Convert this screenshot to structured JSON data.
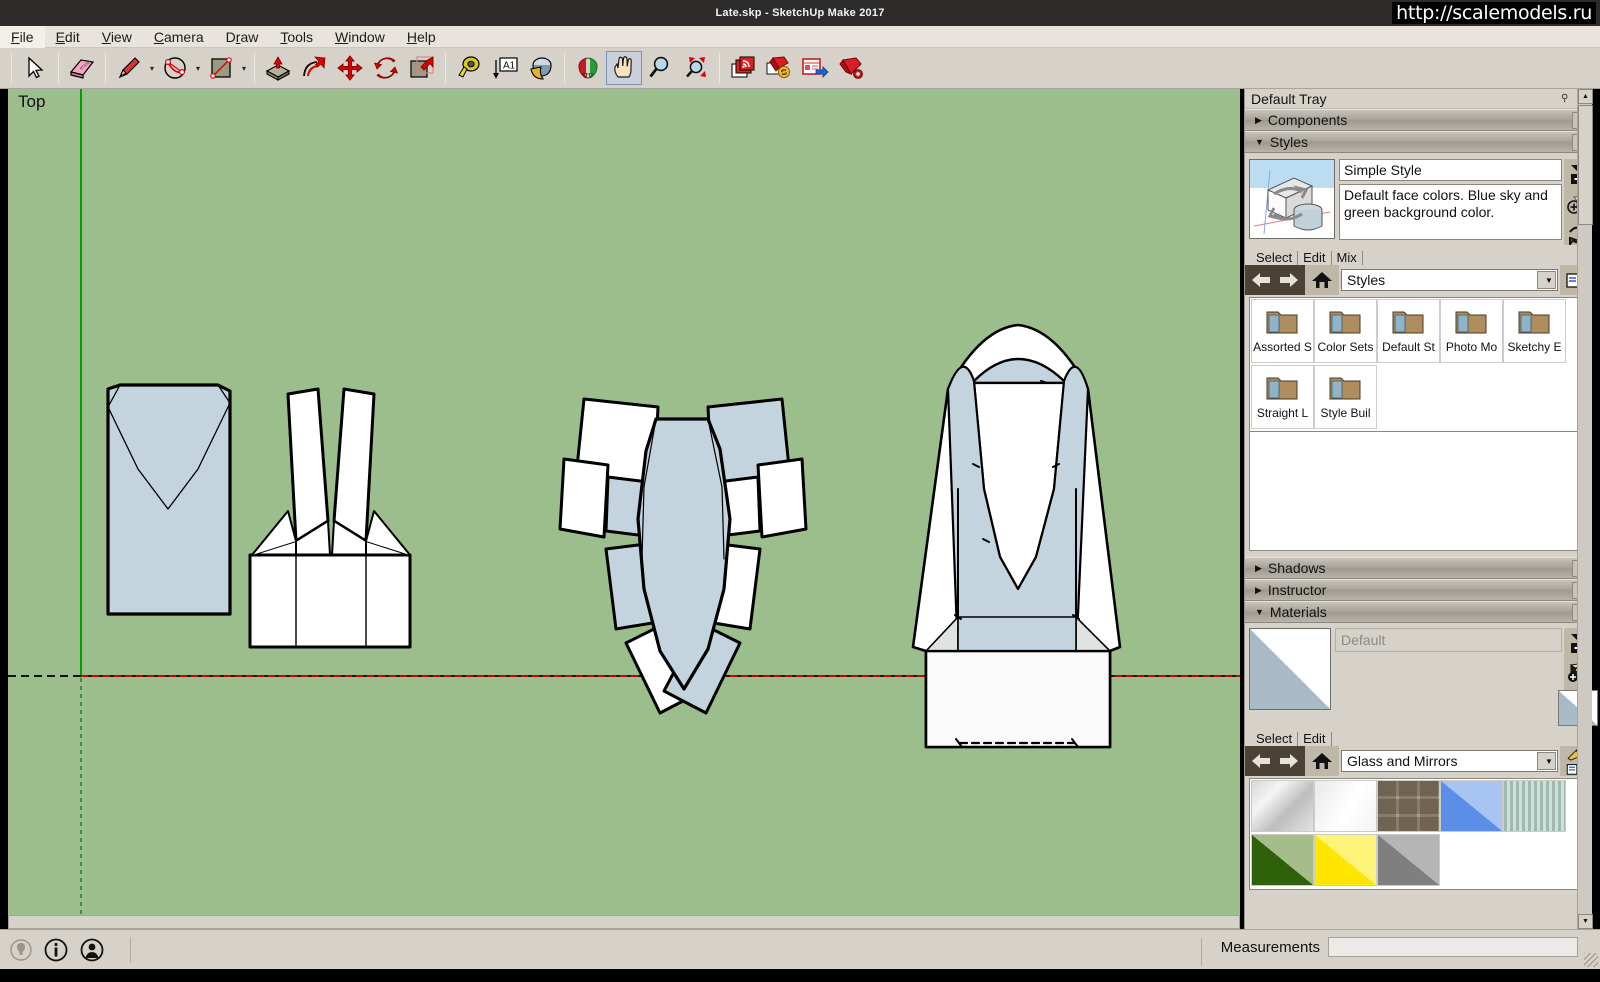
{
  "window": {
    "title": "Late.skp - SketchUp Make 2017",
    "watermark": "http://scalemodels.ru"
  },
  "menubar": {
    "items": [
      {
        "label": "File",
        "mnemonic": "F"
      },
      {
        "label": "Edit",
        "mnemonic": "E"
      },
      {
        "label": "View",
        "mnemonic": "V"
      },
      {
        "label": "Camera",
        "mnemonic": "C"
      },
      {
        "label": "Draw",
        "mnemonic": "D"
      },
      {
        "label": "Tools",
        "mnemonic": "T"
      },
      {
        "label": "Window",
        "mnemonic": "W"
      },
      {
        "label": "Help",
        "mnemonic": "H"
      }
    ]
  },
  "toolbar": {
    "tools": [
      {
        "name": "select-tool",
        "icon": "cursor-arrow-icon",
        "active": false
      },
      {
        "name": "eraser-tool",
        "icon": "eraser-icon",
        "active": false
      },
      {
        "name": "line-tool",
        "icon": "pencil-icon",
        "active": false,
        "caret": true
      },
      {
        "name": "arc-tool",
        "icon": "arc-icon",
        "active": false,
        "caret": true
      },
      {
        "name": "rectangle-tool",
        "icon": "rectangle-icon",
        "active": false,
        "caret": true
      },
      {
        "name": "pushpull-tool",
        "icon": "push-pull-icon",
        "active": false
      },
      {
        "name": "followme-tool",
        "icon": "follow-me-icon",
        "active": false
      },
      {
        "name": "move-tool",
        "icon": "move-icon",
        "active": false
      },
      {
        "name": "rotate-tool",
        "icon": "rotate-icon",
        "active": false
      },
      {
        "name": "scale-tool",
        "icon": "scale-icon",
        "active": false
      },
      {
        "name": "tape-measure-tool",
        "icon": "tape-measure-icon",
        "active": false
      },
      {
        "name": "text-tool",
        "icon": "text-a1-icon",
        "active": false
      },
      {
        "name": "paint-bucket-tool",
        "icon": "paint-bucket-icon",
        "active": false
      },
      {
        "name": "orbit-tool",
        "icon": "orbit-icon",
        "active": false
      },
      {
        "name": "pan-tool",
        "icon": "hand-pan-icon",
        "active": true
      },
      {
        "name": "zoom-tool",
        "icon": "magnifier-icon",
        "active": false
      },
      {
        "name": "zoom-extents-tool",
        "icon": "zoom-extents-icon",
        "active": false
      },
      {
        "name": "get-models-button",
        "icon": "warehouse-models-icon",
        "active": false
      },
      {
        "name": "share-model-button",
        "icon": "share-model-icon",
        "active": false
      },
      {
        "name": "extension-warehouse-button",
        "icon": "extension-warehouse-icon",
        "active": false
      },
      {
        "name": "extension-manager-button",
        "icon": "ruby-gear-icon",
        "active": false
      }
    ]
  },
  "viewport": {
    "view_label": "Top",
    "background_color": "#9cbd8c",
    "face_front_color": "#ffffff",
    "face_back_color": "#c3d4de",
    "axis_green_color": "#00a000",
    "axis_red_color": "#cc0000",
    "edge_color": "#000000"
  },
  "tray": {
    "title": "Default Tray",
    "pin_icon": "pin-icon",
    "close_icon": "close-icon",
    "panels": [
      {
        "name": "Components",
        "expanded": false
      },
      {
        "name": "Styles",
        "expanded": true
      },
      {
        "name": "Shadows",
        "expanded": false
      },
      {
        "name": "Instructor",
        "expanded": false
      },
      {
        "name": "Materials",
        "expanded": true
      }
    ]
  },
  "styles_panel": {
    "style_name": "Simple Style",
    "style_description": "Default face colors. Blue sky and green background color.",
    "tabs": [
      {
        "label": "Select",
        "active": true
      },
      {
        "label": "Edit",
        "active": false
      },
      {
        "label": "Mix",
        "active": false
      }
    ],
    "library": "Styles",
    "side_buttons": [
      {
        "name": "create-style-button",
        "icon": "create-style-icon"
      },
      {
        "name": "update-style-button",
        "icon": "update-style-icon"
      },
      {
        "name": "refresh-style-button",
        "icon": "refresh-icon"
      }
    ],
    "nav": {
      "back_icon": "arrow-left-icon",
      "forward_icon": "arrow-right-icon",
      "home_icon": "home-icon",
      "details_icon": "details-arrow-icon"
    },
    "folders": [
      {
        "label": "Assorted S",
        "icon": "folder-icon"
      },
      {
        "label": "Color Sets",
        "icon": "folder-icon"
      },
      {
        "label": "Default St",
        "icon": "folder-icon"
      },
      {
        "label": "Photo Mo",
        "icon": "folder-icon"
      },
      {
        "label": "Sketchy E",
        "icon": "folder-icon"
      },
      {
        "label": "Straight L",
        "icon": "folder-icon"
      },
      {
        "label": "Style Buil",
        "icon": "folder-icon"
      }
    ]
  },
  "materials_panel": {
    "material_name": "Default",
    "tabs": [
      {
        "label": "Select",
        "active": true
      },
      {
        "label": "Edit",
        "active": false
      }
    ],
    "library": "Glass and Mirrors",
    "side_buttons": [
      {
        "name": "create-material-button",
        "icon": "create-material-icon"
      },
      {
        "name": "set-default-material-button",
        "icon": "default-material-icon"
      },
      {
        "name": "sample-paint-button",
        "icon": "eyedropper-icon"
      },
      {
        "name": "material-details-button",
        "icon": "details-arrow-icon"
      }
    ],
    "swatches": [
      {
        "name": "mirror",
        "colors": [
          "#cfcfcf",
          "#f2f2f2",
          "#9c9c9c"
        ],
        "style": "gradient"
      },
      {
        "name": "translucent-glass",
        "colors": [
          "#ededed",
          "#ffffff"
        ],
        "style": "gradient"
      },
      {
        "name": "glass-block",
        "colors": [
          "#b6b0a4",
          "#8a7f72"
        ],
        "style": "pattern"
      },
      {
        "name": "translucent-glass-blue",
        "colors": [
          "#5b8ee6",
          "#a8c4f2"
        ],
        "style": "split"
      },
      {
        "name": "translucent-glass-corrugated",
        "colors": [
          "#9fbab0",
          "#cfe0d8"
        ],
        "style": "stripes"
      },
      {
        "name": "translucent-glass-green",
        "colors": [
          "#2e6109",
          "#a5bd8b"
        ],
        "style": "split"
      },
      {
        "name": "translucent-glass-yellow",
        "colors": [
          "#ffe600",
          "#fff47a"
        ],
        "style": "split"
      },
      {
        "name": "translucent-glass-gray",
        "colors": [
          "#7f7f7f",
          "#b5b5b5"
        ],
        "style": "split"
      }
    ]
  },
  "statusbar": {
    "icons": [
      {
        "name": "hint-bulb-icon"
      },
      {
        "name": "info-icon"
      },
      {
        "name": "account-icon"
      }
    ],
    "measurements_label": "Measurements",
    "measurements_value": "",
    "measurements_placeholder": ""
  }
}
